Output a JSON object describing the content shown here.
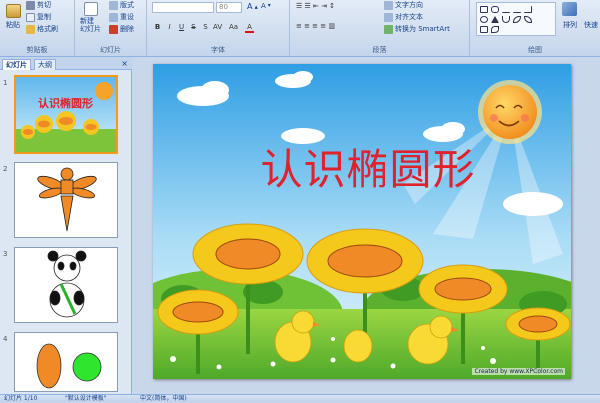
{
  "ribbon": {
    "clipboard": {
      "paste": "粘贴",
      "cut": "剪切",
      "copy": "复制",
      "format_painter": "格式刷",
      "group": "剪贴板"
    },
    "slides": {
      "new_slide": "新建\n幻灯片",
      "layout": "版式",
      "reset": "重设",
      "delete": "删除",
      "group": "幻灯片"
    },
    "font": {
      "font_name": "",
      "font_size": "80",
      "group": "字体"
    },
    "paragraph": {
      "text_direction": "文字方向",
      "align_text": "对齐文本",
      "smartart": "转换为 SmartArt",
      "group": "段落"
    },
    "drawing": {
      "arrange": "排列",
      "quick_styles": "快速",
      "group": "绘图"
    }
  },
  "panel": {
    "tabs": [
      "幻灯片",
      "大纲"
    ],
    "close_symbol": "×",
    "thumbnails": [
      {
        "number": "1",
        "title": "认识椭圆形"
      },
      {
        "number": "2"
      },
      {
        "number": "3"
      },
      {
        "number": "4"
      }
    ]
  },
  "slide": {
    "title": "认识椭圆形",
    "credit": "Created by www.XPColor.com",
    "title_color": "#e0222c",
    "oval_color": "#f08a26"
  },
  "status": {
    "slide_index": "幻灯片 1/10",
    "theme": "\"默认设计模板\"",
    "language": "中文(简体，中国)"
  }
}
